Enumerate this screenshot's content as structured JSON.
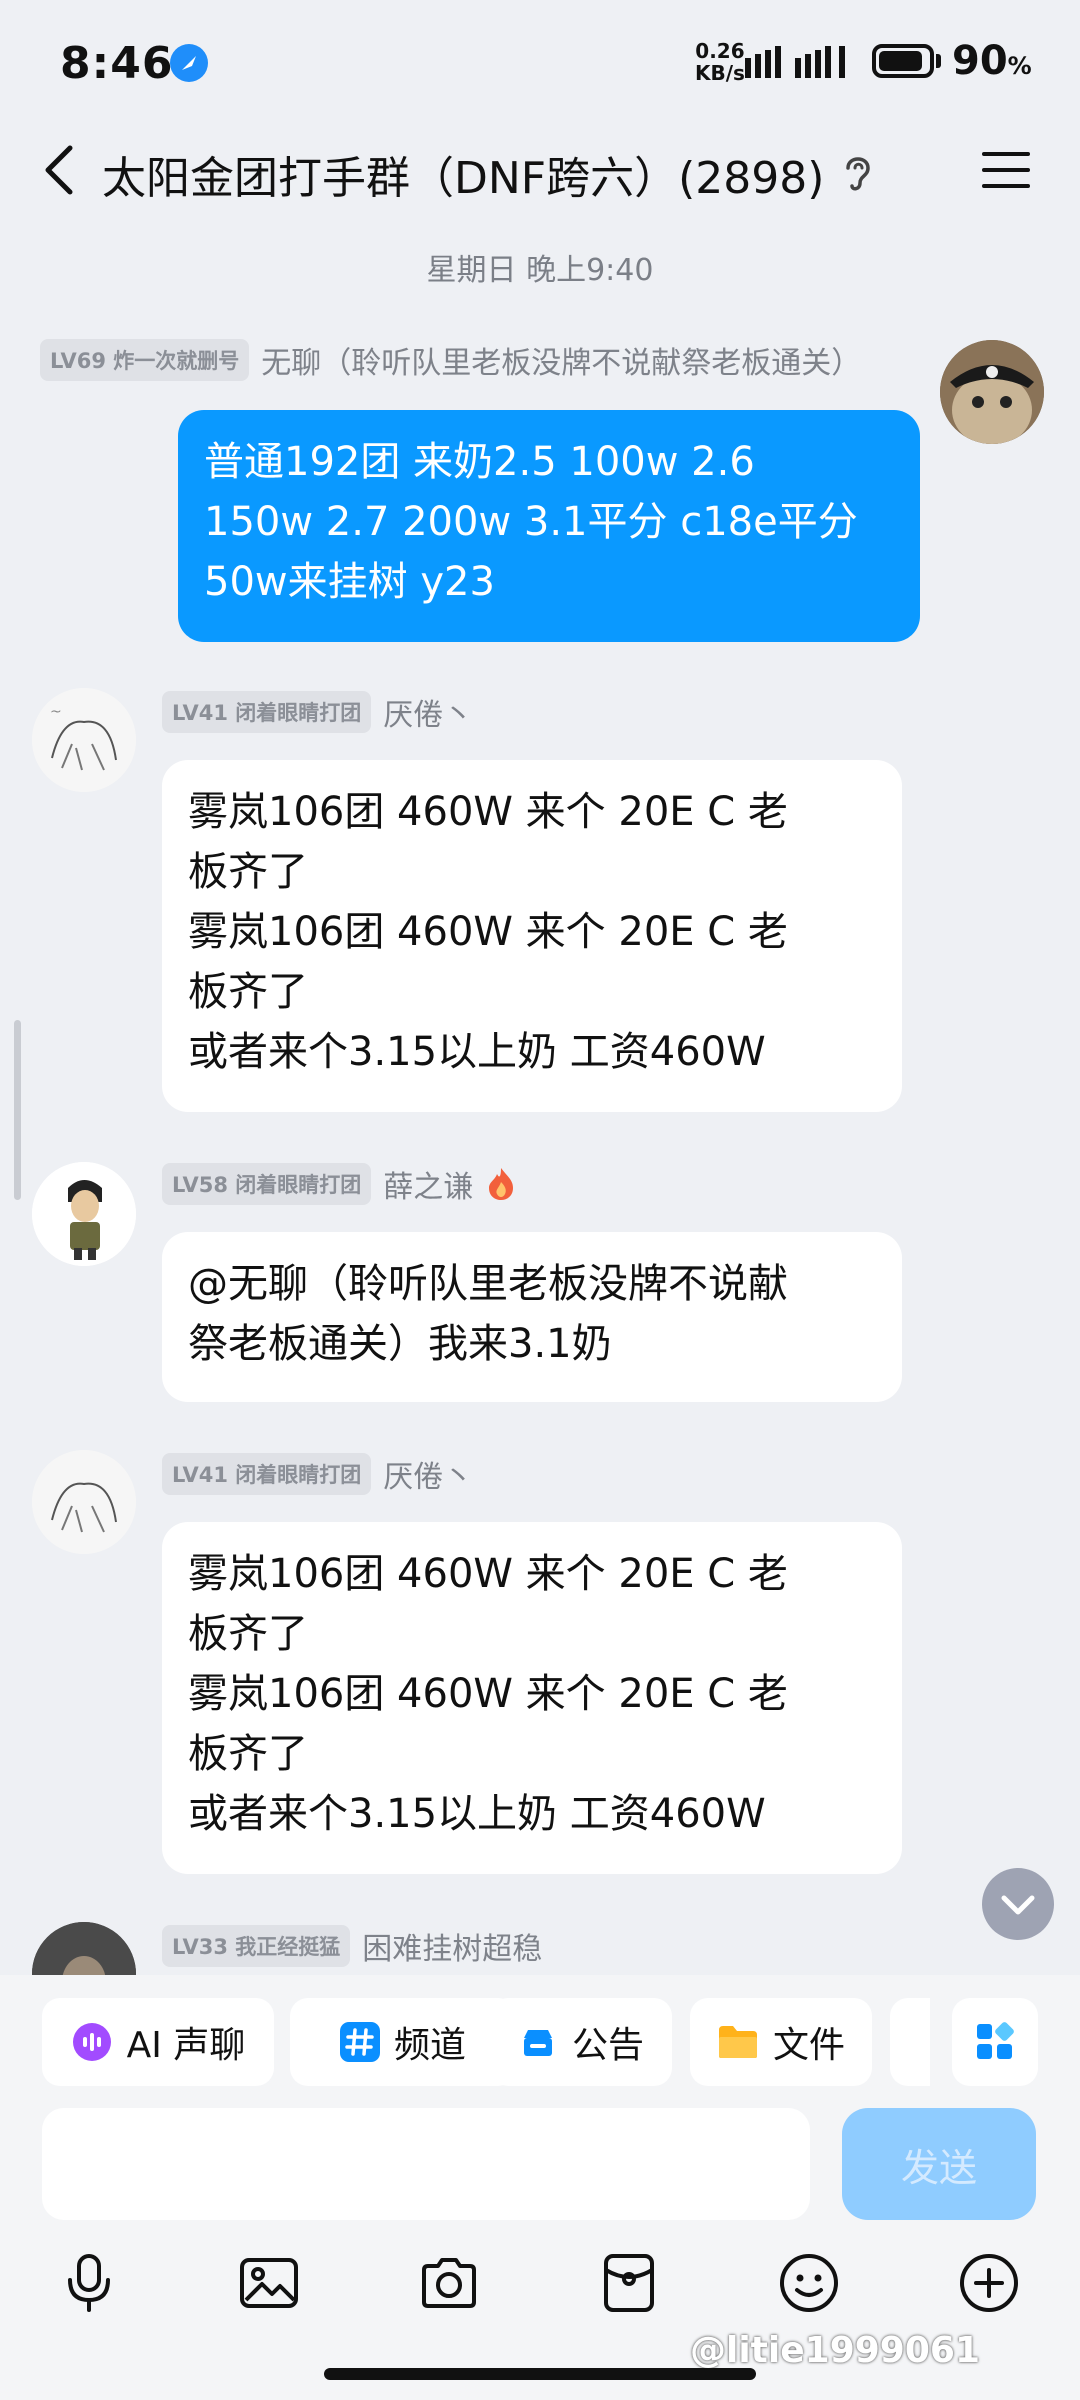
{
  "status_bar": {
    "time": "8:46",
    "net_speed_value": "0.26",
    "net_speed_unit": "KB/s",
    "battery_percent": "90",
    "battery_unit": "%",
    "battery_level": 0.9
  },
  "header": {
    "title": "太阳金团打手群（DNF跨六）(2898)",
    "back_icon": "chevron-left-icon",
    "ear_icon": "ear-icon",
    "menu_icon": "hamburger-menu-icon"
  },
  "time_divider": "星期日 晚上9:40",
  "messages": [
    {
      "badge": "LV69 炸一次就删号",
      "name": "无聊（聆听队里老板没牌不说献祭老板通关）",
      "lines": [
        "普通192团 来奶2.5 100w 2.6",
        "150w 2.7 200w 3.1平分 c18e平分",
        "50w来挂树 y23"
      ]
    },
    {
      "badge": "LV41 闭着眼睛打团",
      "name": "厌倦丶",
      "lines": [
        "雾岚106团 460W 来个 20E C 老",
        "板齐了",
        "雾岚106团 460W 来个 20E C 老",
        "板齐了",
        "或者来个3.15以上奶 工资460W"
      ]
    },
    {
      "badge": "LV58 闭着眼睛打团",
      "name": "薛之谦",
      "lines": [
        "@无聊（聆听队里老板没牌不说献",
        "祭老板通关）我来3.1奶"
      ]
    },
    {
      "badge": "LV41 闭着眼睛打团",
      "name": "厌倦丶",
      "lines": [
        "雾岚106团 460W 来个 20E C 老",
        "板齐了",
        "雾岚106团 460W 来个 20E C 老",
        "板齐了",
        "或者来个3.15以上奶 工资460W"
      ]
    },
    {
      "badge": "LV33 我正经挺猛",
      "name": "困难挂树超稳"
    }
  ],
  "quick_actions": [
    {
      "label": "AI 声聊",
      "icon": "ai-voice-icon"
    },
    {
      "label": "频道",
      "icon": "hash-channel-icon"
    },
    {
      "label": "公告",
      "icon": "announcement-icon"
    },
    {
      "label": "文件",
      "icon": "folder-icon"
    }
  ],
  "composer": {
    "placeholder": "",
    "send_label": "发送"
  },
  "toolbar_icons": [
    "microphone-icon",
    "image-icon",
    "camera-icon",
    "red-packet-icon",
    "emoji-icon",
    "plus-icon"
  ],
  "watermark": "@litie1999061",
  "colors": {
    "accent": "#0a99ff",
    "send_disabled": "#8fccff",
    "background": "#eef0f4"
  }
}
